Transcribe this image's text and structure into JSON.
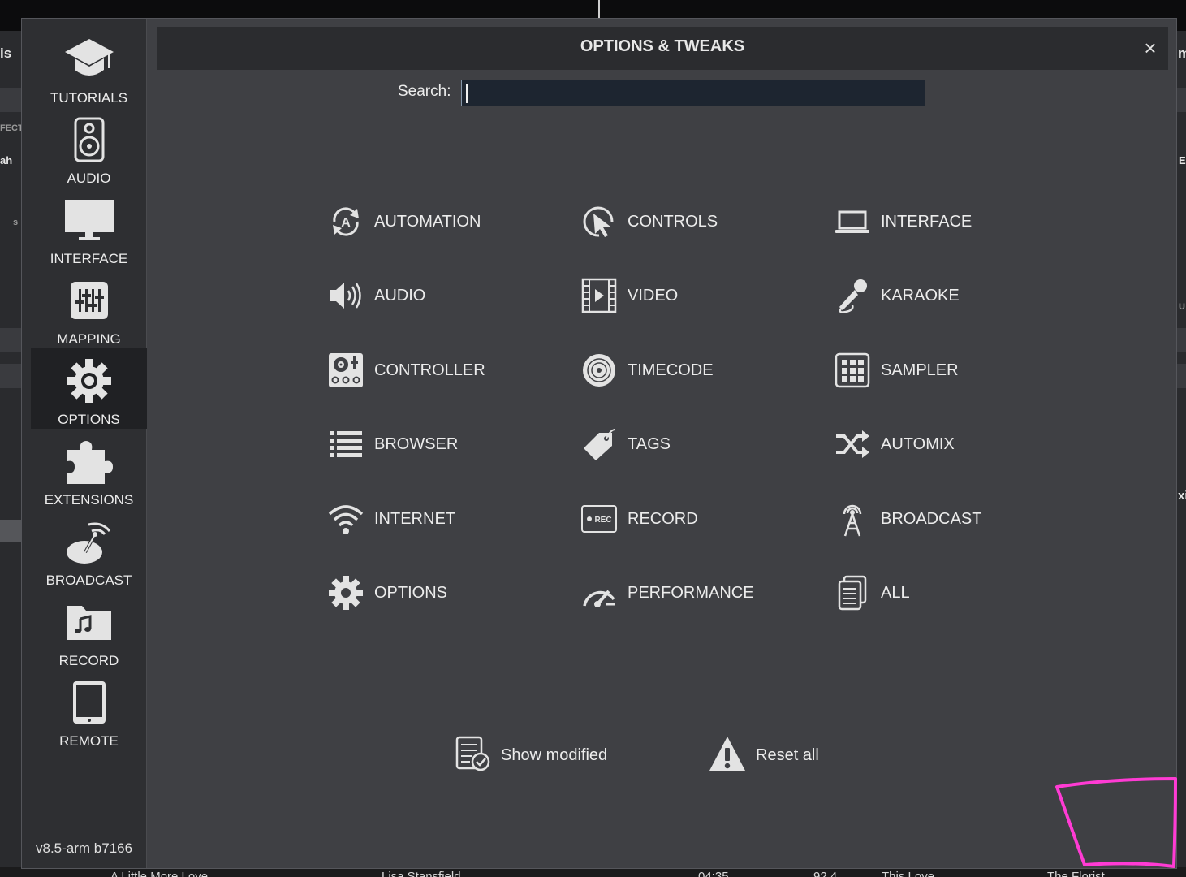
{
  "background": {
    "frag_left_top": "is",
    "frag_right_top": "m",
    "frag_left_fect": "FECT",
    "frag_left_ah": "ah",
    "frag_left_s": "s",
    "frag_right_ec": "Ec",
    "frag_right_xi": "xi",
    "frag_right_u": "U",
    "bottom_row": [
      "A Little More Love",
      "Lisa Stansfield",
      "04:35",
      "92.4",
      "This Love",
      "The Florist"
    ]
  },
  "sidebar": {
    "items": [
      {
        "label": "TUTORIALS",
        "icon": "graduation-cap-icon"
      },
      {
        "label": "AUDIO",
        "icon": "speaker-icon"
      },
      {
        "label": "INTERFACE",
        "icon": "monitor-icon"
      },
      {
        "label": "MAPPING",
        "icon": "sliders-icon"
      },
      {
        "label": "OPTIONS",
        "icon": "gear-icon",
        "active": true
      },
      {
        "label": "EXTENSIONS",
        "icon": "puzzle-icon"
      },
      {
        "label": "BROADCAST",
        "icon": "satellite-dish-icon"
      },
      {
        "label": "RECORD",
        "icon": "music-folder-icon"
      },
      {
        "label": "REMOTE",
        "icon": "tablet-icon"
      }
    ],
    "version": "v8.5-arm b7166"
  },
  "dialog": {
    "title": "OPTIONS & TWEAKS",
    "close_label": "×",
    "search_label": "Search:",
    "search_value": ""
  },
  "categories": [
    {
      "label": "AUTOMATION",
      "icon": "automation-icon"
    },
    {
      "label": "CONTROLS",
      "icon": "cursor-click-icon"
    },
    {
      "label": "INTERFACE",
      "icon": "laptop-icon"
    },
    {
      "label": "AUDIO",
      "icon": "volume-icon"
    },
    {
      "label": "VIDEO",
      "icon": "film-icon"
    },
    {
      "label": "KARAOKE",
      "icon": "microphone-icon"
    },
    {
      "label": "CONTROLLER",
      "icon": "dj-controller-icon"
    },
    {
      "label": "TIMECODE",
      "icon": "vinyl-icon"
    },
    {
      "label": "SAMPLER",
      "icon": "pad-grid-icon"
    },
    {
      "label": "BROWSER",
      "icon": "list-icon"
    },
    {
      "label": "TAGS",
      "icon": "tag-icon"
    },
    {
      "label": "AUTOMIX",
      "icon": "shuffle-icon"
    },
    {
      "label": "INTERNET",
      "icon": "wifi-icon"
    },
    {
      "label": "RECORD",
      "icon": "rec-icon"
    },
    {
      "label": "BROADCAST",
      "icon": "antenna-icon"
    },
    {
      "label": "OPTIONS",
      "icon": "gear-icon"
    },
    {
      "label": "PERFORMANCE",
      "icon": "gauge-icon"
    },
    {
      "label": "ALL",
      "icon": "documents-icon"
    }
  ],
  "actions": {
    "show_modified": "Show modified",
    "reset_all": "Reset all"
  },
  "colors": {
    "panel": "#3f4044",
    "sidebar": "#2e2f32",
    "annotation": "#ff3bd4"
  }
}
